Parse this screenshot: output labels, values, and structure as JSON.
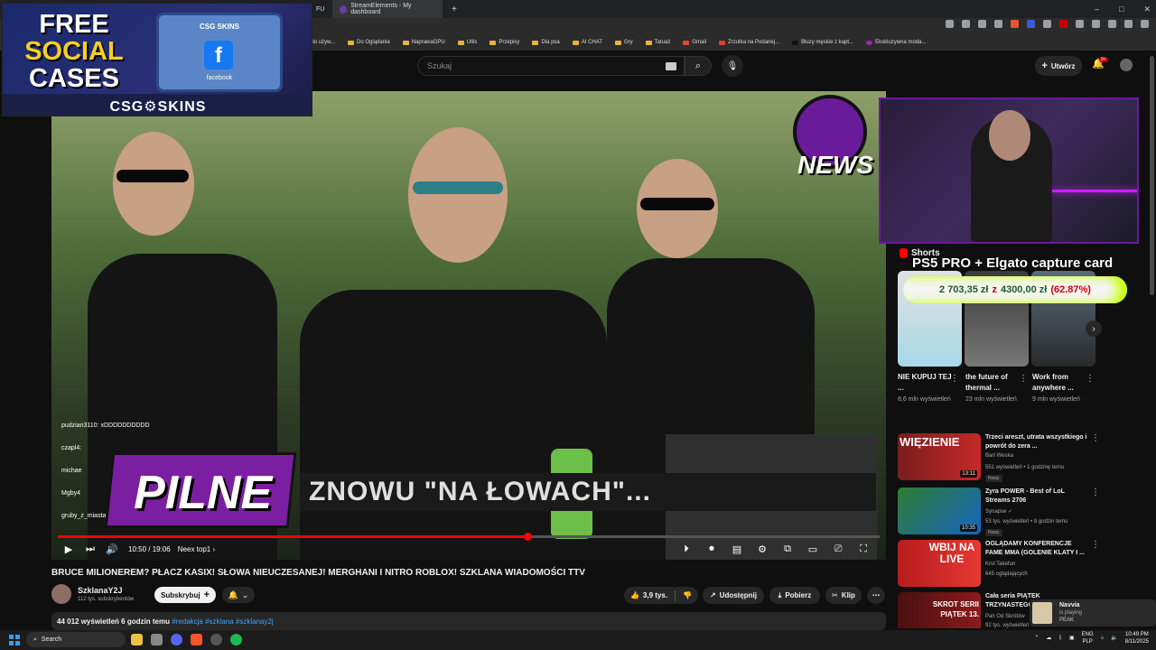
{
  "browser": {
    "tabs": [
      {
        "label": "FU"
      },
      {
        "label": "StreamElements - My dashboard"
      }
    ],
    "new_tab": "+",
    "window_controls": {
      "minimize": "–",
      "maximize": "□",
      "close": "✕"
    },
    "bookmarks": [
      {
        "label": "ało używ..."
      },
      {
        "label": "Do Oglądania"
      },
      {
        "label": "NaprawaGPU"
      },
      {
        "label": "Utils"
      },
      {
        "label": "Przepisy"
      },
      {
        "label": "Dla psa"
      },
      {
        "label": "AI CHAT"
      },
      {
        "label": "Gry"
      },
      {
        "label": "Tatuaż"
      },
      {
        "label": "Gmail"
      },
      {
        "label": "Zrzutka na Podanej..."
      },
      {
        "label": "Bluzy męskie z kapt..."
      },
      {
        "label": "Ekskluzywna moda..."
      }
    ]
  },
  "youtube_header": {
    "search_placeholder": "Szukaj",
    "create_label": "Utwórz",
    "notifications_badge": "9+"
  },
  "ad_overlay": {
    "line1": "FREE",
    "line2": "SOCIAL",
    "line3": "CASES",
    "box_label": "CSG SKINS",
    "box_sublabel": "facebook",
    "brand": "CSG⚙SKINS"
  },
  "video": {
    "news_logo_text": "NEWS",
    "chat_lines": [
      {
        "user": "pudzian3110:",
        "text": "xDDDDDDDDDD"
      },
      {
        "user": "czapl4:",
        "text": ""
      },
      {
        "user": "michae",
        "text": ""
      },
      {
        "user": "Mgby4",
        "text": ""
      },
      {
        "user": "gruby_z_miasta1:",
        "text": ""
      }
    ],
    "pilne_label": "PILNE",
    "headline": "ZNOWU \"NA ŁOWACH\"...",
    "time_current": "10:50",
    "time_total": "19:06",
    "time_separator": "/",
    "chapter": "Neex top1",
    "progress": 0.571
  },
  "video_info": {
    "title": "BRUCE MILIONEREM? PŁACZ KASIX! SŁOWA NIEUCZESANEJ! MERGHANI I NITRO ROBLOX! SZKLANA WIADOMOŚCI TTV",
    "channel_name": "SzklanaY2J",
    "subscribers": "112 tys. subskrybentów",
    "subscribe_label": "Subskrybuj",
    "likes": "3,9 tys.",
    "share_label": "Udostępnij",
    "download_label": "Pobierz",
    "clip_label": "Klip",
    "views": "44 012 wyświetleń",
    "posted": "6 godzin temu",
    "tags": "#redakcja #szklana #szklanay2j"
  },
  "sidebar": {
    "shorts_header": "Shorts",
    "overlay_title": "PS5 PRO + Elgato capture card",
    "price_current": "2 703,35 zł",
    "price_from_word": "z",
    "price_target": "4300,00 zł",
    "price_percent": "(62.87%)",
    "shorts": [
      {
        "title": "NIE KUPUJ TEJ ...",
        "views": "8,6 mln wyświetleń"
      },
      {
        "title": "the future of thermal ...",
        "views": "23 mln wyświetleń"
      },
      {
        "title": "Work from anywhere ...",
        "views": "9 mln wyświetleń"
      }
    ],
    "recommended": [
      {
        "thumb_text": "WIĘZIENIE",
        "duration": "13:11",
        "title": "Trzeci areszt, utrata wszystkiego i powrót do zera ...",
        "channel": "Bart Weska",
        "meta": "551 wyświetleń • 1 godzinę temu",
        "badge": "Nowy"
      },
      {
        "thumb_text": "",
        "duration": "10:35",
        "title": "Zyra POWER - Best of LoL Streams 2706",
        "channel": "Synapse ✓",
        "meta": "53 tys. wyświetleń • 8 godzin temu",
        "badge": "Nowy"
      },
      {
        "thumb_text": "WBIJ NA LIVE",
        "duration": "",
        "title": "OGLĄDAMY KONFERENCJE FAME MMA (GOLENIE KLATY I ...",
        "channel": "Krul Takefun",
        "meta": "645 oglądających",
        "badge": ""
      },
      {
        "thumb_text": "SKROT SERII PIĄTEK 13.",
        "duration": "",
        "title": "Cała seria PIĄTEK TRZYNASTEGO",
        "channel": "Pan Od Skrótów",
        "meta": "92 tys. wyświetleń",
        "badge": ""
      }
    ]
  },
  "now_playing": {
    "title": "Navvia",
    "status": "is playing",
    "track": "PEAK"
  },
  "taskbar": {
    "search_label": "Search",
    "lang": "ENG",
    "lang_sub": "PLP",
    "time": "10:49 PM",
    "date": "8/11/2025"
  },
  "colors": {
    "accent_red": "#ff0000",
    "yt_bg": "#0f0f0f",
    "purple_brand": "#7b1fa2",
    "link_blue": "#3ea6ff"
  }
}
